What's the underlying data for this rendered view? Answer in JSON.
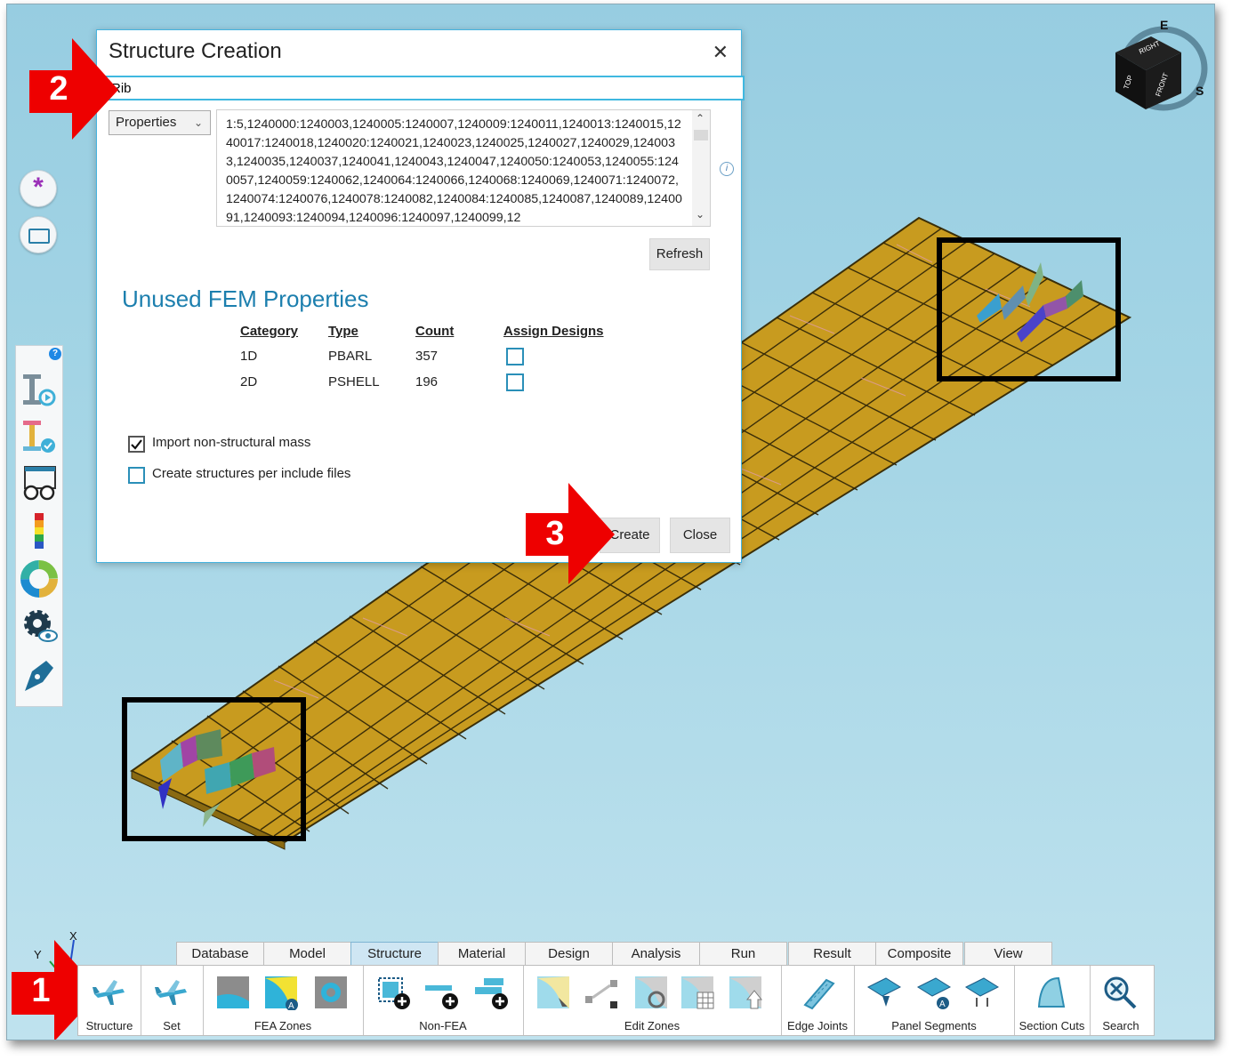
{
  "dialog": {
    "title": "Structure Creation",
    "close_symbol": "✕",
    "name_value": "Rib",
    "source_select": "Properties",
    "id_list": "1:5,1240000:1240003,1240005:1240007,1240009:1240011,1240013:1240015,1240017:1240018,1240020:1240021,1240023,1240025,1240027,1240029,1240033,1240035,1240037,1240041,1240043,1240047,1240050:1240053,1240055:1240057,1240059:1240062,1240064:1240066,1240068:1240069,1240071:1240072,1240074:1240076,1240078:1240082,1240084:1240085,1240087,1240089,1240091,1240093:1240094,1240096:1240097,1240099,12",
    "refresh_label": "Refresh",
    "unused_title": "Unused FEM Properties",
    "table": {
      "headers": [
        "Category",
        "Type",
        "Count",
        "Assign Designs"
      ],
      "rows": [
        {
          "category": "1D",
          "type": "PBARL",
          "count": "357",
          "assign": false
        },
        {
          "category": "2D",
          "type": "PSHELL",
          "count": "196",
          "assign": false
        }
      ]
    },
    "options": [
      {
        "label": "Import non-structural mass",
        "checked": true
      },
      {
        "label": "Create structures per include files",
        "checked": false
      }
    ],
    "create_label": "Create",
    "close_label": "Close"
  },
  "callouts": [
    "1",
    "2",
    "3"
  ],
  "ribbon": {
    "tabs": [
      "Database",
      "Model",
      "Structure",
      "Material",
      "Design",
      "Analysis",
      "Run",
      "Result",
      "Composite",
      "View"
    ],
    "active_tab": "Structure",
    "groups": [
      {
        "label": "",
        "buttons": [
          "Structure"
        ]
      },
      {
        "label": "",
        "buttons": [
          "Set"
        ]
      },
      {
        "label": "FEA Zones"
      },
      {
        "label": "Non-FEA"
      },
      {
        "label": "Edit Zones"
      },
      {
        "label": "Edge Joints"
      },
      {
        "label": "Panel Segments"
      },
      {
        "label": "Section Cuts"
      },
      {
        "label": "Search"
      }
    ]
  },
  "axes": {
    "x": "X",
    "y": "Y"
  },
  "view_cube": {
    "labels": [
      "TOP",
      "RIGHT",
      "FRONT"
    ],
    "compass": [
      "E",
      "S"
    ]
  },
  "colors": {
    "accent": "#3fb8e0",
    "section_title": "#1c7fae",
    "model_fill": "#c79a1e",
    "callout_red": "#ee0000"
  }
}
